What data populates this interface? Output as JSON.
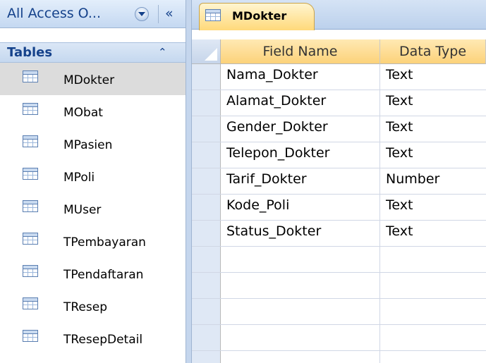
{
  "nav": {
    "title": "All Access O...",
    "collapse_glyph": "«",
    "group": {
      "label": "Tables",
      "toggle_glyph": "⌃"
    },
    "items": [
      {
        "label": "MDokter",
        "icon": "table-icon",
        "selected": true
      },
      {
        "label": "MObat",
        "icon": "table-icon",
        "selected": false
      },
      {
        "label": "MPasien",
        "icon": "table-icon",
        "selected": false
      },
      {
        "label": "MPoli",
        "icon": "table-icon",
        "selected": false
      },
      {
        "label": "MUser",
        "icon": "table-icon",
        "selected": false
      },
      {
        "label": "TPembayaran",
        "icon": "table-icon",
        "selected": false
      },
      {
        "label": "TPendaftaran",
        "icon": "table-icon",
        "selected": false
      },
      {
        "label": "TResep",
        "icon": "table-icon",
        "selected": false
      },
      {
        "label": "TResepDetail",
        "icon": "table-icon",
        "selected": false
      }
    ]
  },
  "document": {
    "tab": {
      "label": "MDokter",
      "icon": "table-icon"
    },
    "columns": [
      "Field Name",
      "Data Type"
    ],
    "rows": [
      {
        "field": "Nama_Dokter",
        "type": "Text"
      },
      {
        "field": "Alamat_Dokter",
        "type": "Text"
      },
      {
        "field": "Gender_Dokter",
        "type": "Text"
      },
      {
        "field": "Telepon_Dokter",
        "type": "Text"
      },
      {
        "field": "Tarif_Dokter",
        "type": "Number"
      },
      {
        "field": "Kode_Poli",
        "type": "Text"
      },
      {
        "field": "Status_Dokter",
        "type": "Text"
      },
      {
        "field": "",
        "type": ""
      },
      {
        "field": "",
        "type": ""
      },
      {
        "field": "",
        "type": ""
      },
      {
        "field": "",
        "type": ""
      },
      {
        "field": "",
        "type": ""
      }
    ]
  },
  "colors": {
    "nav_header": "#c4d8f1",
    "tab_active": "#ffd97a",
    "header_cells": "#fcd27a",
    "selected_item": "#dcdcdc",
    "accent_text": "#15428b"
  }
}
